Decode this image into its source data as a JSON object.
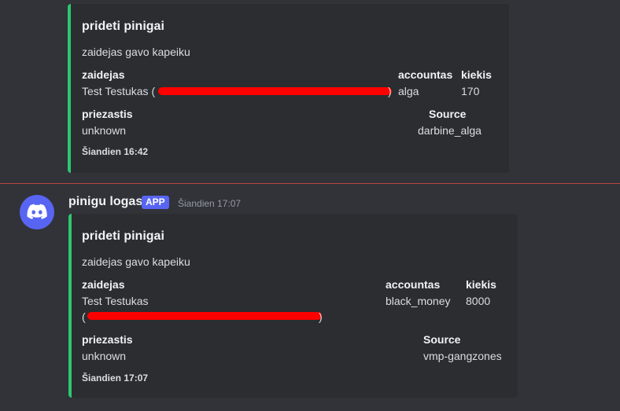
{
  "colors": {
    "background": "#313338",
    "embed_bg": "#2b2d31",
    "embed_accent": "#2dc770",
    "new_divider": "#e04d45",
    "app_badge": "#5865f2",
    "redaction": "#ff0000"
  },
  "embed1": {
    "title": "prideti pinigai",
    "description": "zaidejas gavo kapeiku",
    "fields": {
      "zaidejas_name": "zaidejas",
      "zaidejas_value": "Test Testukas (",
      "zaidejas_close": ")",
      "accountas_name": "accountas",
      "accountas_value": "alga",
      "kiekis_name": "kiekis",
      "kiekis_value": "170",
      "priezastis_name": "priezastis",
      "priezastis_value": "unknown",
      "source_name": "Source",
      "source_value": "darbine_alga"
    },
    "footer": "Šiandien 16:42"
  },
  "message2": {
    "username": "pinigu logas",
    "badge": "APP",
    "timestamp": "Šiandien 17:07",
    "avatar_icon": "discord-icon"
  },
  "embed2": {
    "title": "prideti pinigai",
    "description": "zaidejas gavo kapeiku",
    "fields": {
      "zaidejas_name": "zaidejas",
      "zaidejas_value": "Test Testukas",
      "zaidejas_open": "(",
      "zaidejas_close": ")",
      "accountas_name": "accountas",
      "accountas_value": "black_money",
      "kiekis_name": "kiekis",
      "kiekis_value": "8000",
      "priezastis_name": "priezastis",
      "priezastis_value": "unknown",
      "source_name": "Source",
      "source_value": "vmp-gangzones"
    },
    "footer": "Šiandien 17:07"
  }
}
